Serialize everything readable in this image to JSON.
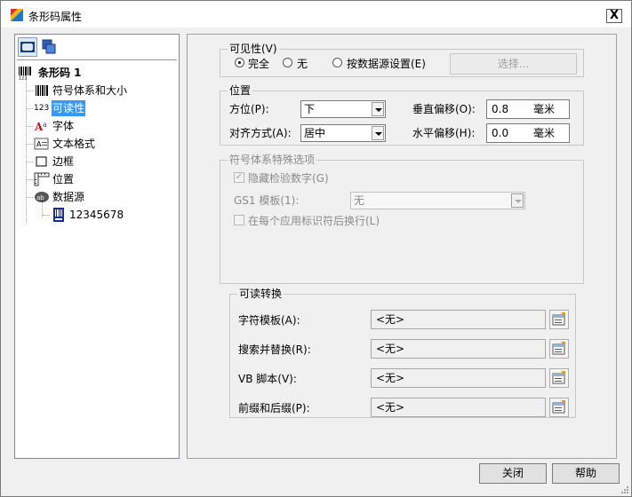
{
  "window": {
    "title": "条形码属性",
    "close_glyph": "X"
  },
  "tree": {
    "root": "条形码 1",
    "items": [
      {
        "label": "符号体系和大小",
        "icon": "barcode-icon"
      },
      {
        "label": "可读性",
        "icon": "readable-123-icon",
        "prefix": "123",
        "selected": true
      },
      {
        "label": "字体",
        "icon": "font-icon"
      },
      {
        "label": "文本格式",
        "icon": "text-format-icon"
      },
      {
        "label": "边框",
        "icon": "border-icon"
      },
      {
        "label": "位置",
        "icon": "ruler-icon"
      },
      {
        "label": "数据源",
        "icon": "data-source-icon"
      }
    ],
    "child": "12345678"
  },
  "visibility": {
    "title": "可见性(V)",
    "options": [
      "完全",
      "无",
      "按数据源设置(E)"
    ],
    "selected": "完全",
    "select_button": "选择..."
  },
  "position": {
    "title": "位置",
    "placement_label": "方位(P):",
    "placement_value": "下",
    "alignment_label": "对齐方式(A):",
    "alignment_value": "居中",
    "v_offset_label": "垂直偏移(O):",
    "v_offset_value": "0.8",
    "h_offset_label": "水平偏移(H):",
    "h_offset_value": "0.0",
    "unit": "毫米"
  },
  "symbology_options": {
    "title": "符号体系特殊选项",
    "hide_check_digit": "隐藏检验数字(G)",
    "gs1_label": "GS1 模板(1):",
    "gs1_value": "无",
    "newline_after_ai": "在每个应用标识符后换行(L)"
  },
  "readable_transform": {
    "title": "可读转换",
    "rows": [
      {
        "label": "字符模板(A):",
        "value": "<无>"
      },
      {
        "label": "搜索并替换(R):",
        "value": "<无>"
      },
      {
        "label": "VB 脚本(V):",
        "value": "<无>"
      },
      {
        "label": "前缀和后缀(P):",
        "value": "<无>"
      }
    ]
  },
  "buttons": {
    "close": "关闭",
    "help": "帮助"
  },
  "colors": {
    "selection": "#3399ff",
    "face": "#f0f0f0"
  }
}
